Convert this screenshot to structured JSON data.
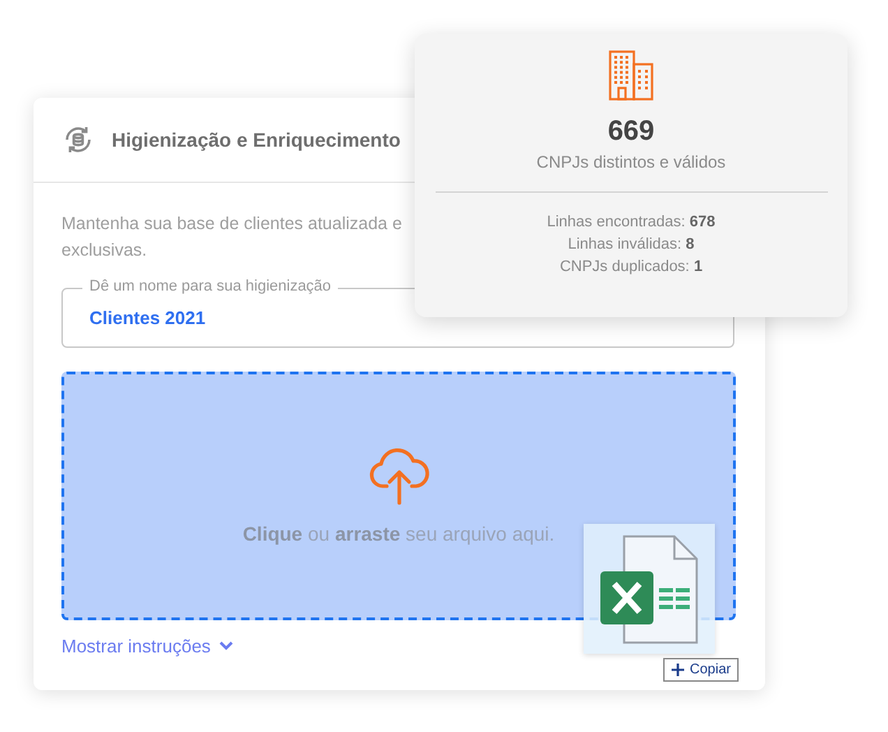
{
  "card": {
    "title": "Higienização e Enriquecimento",
    "description_lines": [
      "Mantenha sua base de clientes atualizada e",
      "exclusivas."
    ],
    "name_field": {
      "label": "Dê um nome para sua higienização",
      "value": "Clientes 2021"
    },
    "dropzone": {
      "text": "**Clique** ou **arraste** seu arquivo aqui."
    },
    "instructions_link": "Mostrar instruções"
  },
  "drag_preview": {
    "tooltip": "Copiar"
  },
  "summary": {
    "count": "669",
    "caption": "CNPJs distintos e válidos",
    "stats": [
      "Linhas encontradas: **678**",
      "Linhas inválidas: **8**",
      "CNPJs duplicados: **1**"
    ]
  }
}
